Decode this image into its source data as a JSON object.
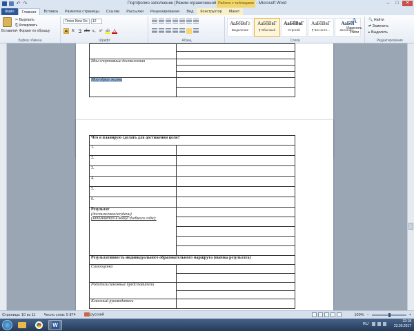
{
  "window": {
    "title": "Портфолио заполнение [Режим ограниченной функциональности] - Microsoft Word",
    "context_tab_group": "Работа с таблицами"
  },
  "tabs": [
    "Файл",
    "Главная",
    "Вставка",
    "Разметка страницы",
    "Ссылки",
    "Рассылки",
    "Рецензирование",
    "Вид",
    "Конструктор",
    "Макет"
  ],
  "ribbon": {
    "clipboard": {
      "paste": "Вставить",
      "cut": "Вырезать",
      "copy": "Копировать",
      "format_painter": "Формат по образцу",
      "label": "Буфер обмена"
    },
    "font": {
      "name": "Times New Ro",
      "size": "12",
      "label": "Шрифт",
      "bold": "Ж",
      "italic": "К",
      "underline": "Ч"
    },
    "paragraph": {
      "label": "Абзац"
    },
    "styles": {
      "items": [
        {
          "sample": "АаБбВвГг",
          "name": "Выделение"
        },
        {
          "sample": "АаБбВвГ",
          "name": "¶ Обычный"
        },
        {
          "sample": "АаБбВвГ",
          "name": "Строгий"
        },
        {
          "sample": "АаБбВвГ",
          "name": "¶ Без инте..."
        },
        {
          "sample": "АаБбI",
          "name": "Заголово..."
        }
      ],
      "change": "Изменить стили",
      "label": "Стили"
    },
    "editing": {
      "find": "Найти",
      "replace": "Заменить",
      "select": "Выделить",
      "label": "Редактирование"
    }
  },
  "page1": {
    "rows": [
      {
        "left": "",
        "right_lines": 2
      },
      {
        "left": "Мои спортивные достижения",
        "right_lines": 3
      },
      {
        "left": "Мой образ жизни",
        "right_lines": 2
      }
    ]
  },
  "page2": {
    "header": "Что я планирую сделать для достижения цели?",
    "numbered": [
      "1.",
      "2.",
      "3.",
      "4.",
      "5.",
      "6."
    ],
    "result_title": "Результат",
    "result_sub1": "(достижения/неудачи)",
    "result_sub2": "(заполняется в конце учебного года):",
    "effectiveness": "Результативность индивидуального образовательного маршрута (оценка результата)",
    "self": "Самооценка",
    "parents": "Родители/законные представители",
    "teacher": "Классный руководитель"
  },
  "status": {
    "page": "Страница: 10 из 11",
    "words": "Число слов: 5 874",
    "language": "русский",
    "zoom": "100%"
  },
  "taskbar": {
    "lang": "RU",
    "time": "22:18",
    "date": "23.06.2017"
  }
}
